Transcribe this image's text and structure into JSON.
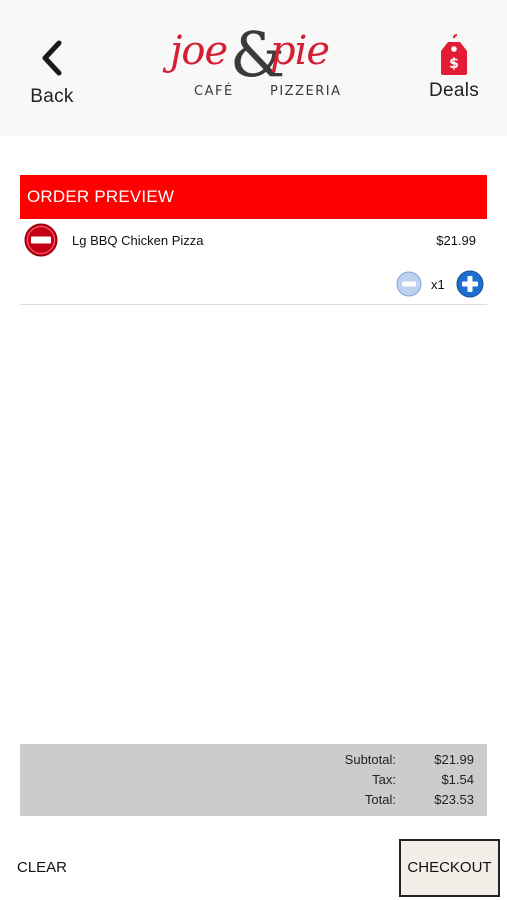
{
  "header": {
    "back_label": "Back",
    "deals_label": "Deals",
    "logo": {
      "line1_left": "joe",
      "ampersand": "&",
      "line1_right": "pie",
      "line2_left": "CAFÉ",
      "line2_right": "PIZZERIA"
    }
  },
  "order": {
    "title": "ORDER PREVIEW",
    "items": [
      {
        "name": "Lg BBQ Chicken Pizza",
        "price": "$21.99",
        "quantity": "x1"
      }
    ]
  },
  "totals": {
    "subtotal_label": "Subtotal:",
    "subtotal_value": "$21.99",
    "tax_label": "Tax:",
    "tax_value": "$1.54",
    "total_label": "Total:",
    "total_value": "$23.53"
  },
  "footer": {
    "clear_label": "CLEAR",
    "checkout_label": "CHECKOUT"
  },
  "colors": {
    "brand_red": "#fe0000",
    "logo_red": "#d51f35",
    "logo_dark": "#3a3a3a",
    "totals_bg": "#cccccc",
    "checkout_bg": "#f1efe7",
    "qty_blue": "#1f6fd1"
  },
  "icons": {
    "back": "chevron-left-icon",
    "deals": "price-tag-icon",
    "remove": "remove-circle-icon",
    "decrease": "minus-circle-icon",
    "increase": "plus-circle-icon"
  }
}
